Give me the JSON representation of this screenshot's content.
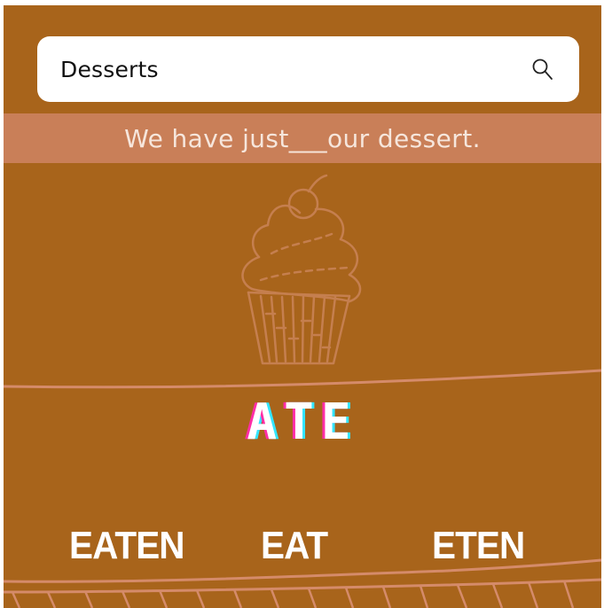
{
  "search": {
    "value": "Desserts",
    "icon": "search-icon"
  },
  "question": {
    "text": "We have just___our dessert."
  },
  "illustration": {
    "icon": "cupcake-icon"
  },
  "answer": {
    "word": "ATE"
  },
  "options": [
    "EATEN",
    "EAT",
    "ETEN"
  ],
  "colors": {
    "background": "#a8641b",
    "banner": "#c97f58",
    "line": "#d58b6a",
    "answer_shadow_pink": "#ff2da6",
    "answer_shadow_cyan": "#33e5ff"
  }
}
